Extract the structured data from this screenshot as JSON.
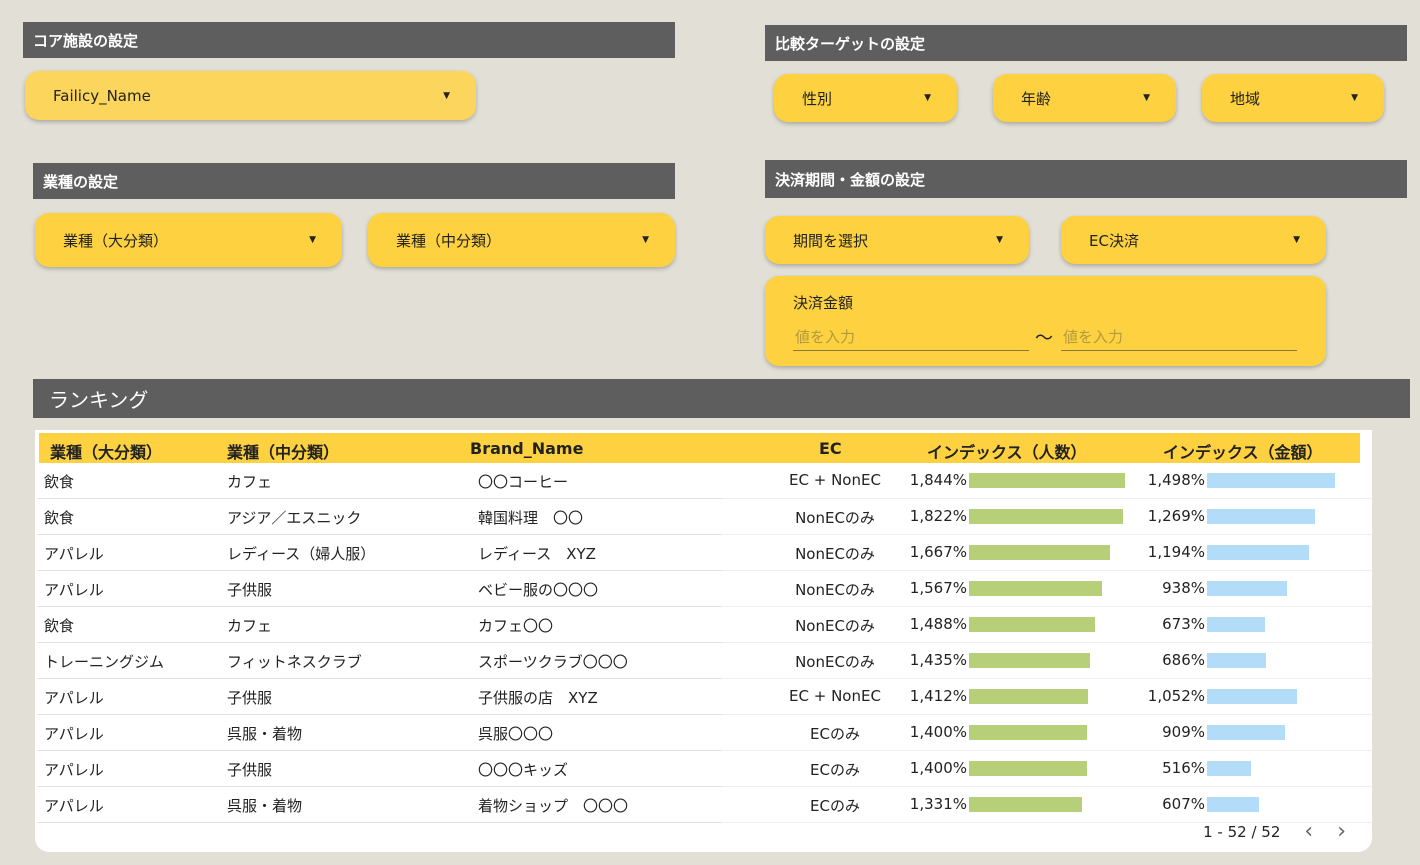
{
  "core": {
    "header": "コア施設の設定",
    "facility": "Failicy_Name"
  },
  "target": {
    "header": "比較ターゲットの設定",
    "gender": "性別",
    "age": "年齢",
    "region": "地域"
  },
  "industry": {
    "header": "業種の設定",
    "major": "業種（大分類）",
    "middle": "業種（中分類）"
  },
  "payment": {
    "header": "決済期間・金額の設定",
    "period": "期間を選択",
    "ec": "EC決済",
    "amount_label": "決済金額",
    "placeholder": "値を入力",
    "tilde": "〜"
  },
  "ranking": {
    "header": "ランキング",
    "columns": [
      "業種（大分類）",
      "業種（中分類）",
      "Brand_Name",
      "EC",
      "インデックス（人数）",
      "インデックス（金額）"
    ],
    "rows": [
      {
        "major": "飲食",
        "middle": "カフェ",
        "brand": "〇〇コーヒー",
        "ec": "EC + NonEC",
        "idx_people": "1,844%",
        "people": 1844,
        "idx_amount": "1,498%",
        "amount": 1498
      },
      {
        "major": "飲食",
        "middle": "アジア／エスニック",
        "brand": "韓国料理　〇〇",
        "ec": "NonECのみ",
        "idx_people": "1,822%",
        "people": 1822,
        "idx_amount": "1,269%",
        "amount": 1269
      },
      {
        "major": "アパレル",
        "middle": "レディース（婦人服）",
        "brand": "レディース　XYZ",
        "ec": "NonECのみ",
        "idx_people": "1,667%",
        "people": 1667,
        "idx_amount": "1,194%",
        "amount": 1194
      },
      {
        "major": "アパレル",
        "middle": "子供服",
        "brand": "ベビー服の〇〇〇",
        "ec": "NonECのみ",
        "idx_people": "1,567%",
        "people": 1567,
        "idx_amount": "938%",
        "amount": 938
      },
      {
        "major": "飲食",
        "middle": "カフェ",
        "brand": "カフェ〇〇",
        "ec": "NonECのみ",
        "idx_people": "1,488%",
        "people": 1488,
        "idx_amount": "673%",
        "amount": 673
      },
      {
        "major": "トレーニングジム",
        "middle": "フィットネスクラブ",
        "brand": "スポーツクラブ〇〇〇",
        "ec": "NonECのみ",
        "idx_people": "1,435%",
        "people": 1435,
        "idx_amount": "686%",
        "amount": 686
      },
      {
        "major": "アパレル",
        "middle": "子供服",
        "brand": "子供服の店　XYZ",
        "ec": "EC + NonEC",
        "idx_people": "1,412%",
        "people": 1412,
        "idx_amount": "1,052%",
        "amount": 1052
      },
      {
        "major": "アパレル",
        "middle": "呉服・着物",
        "brand": "呉服〇〇〇",
        "ec": "ECのみ",
        "idx_people": "1,400%",
        "people": 1400,
        "idx_amount": "909%",
        "amount": 909
      },
      {
        "major": "アパレル",
        "middle": "子供服",
        "brand": "〇〇〇キッズ",
        "ec": "ECのみ",
        "idx_people": "1,400%",
        "people": 1400,
        "idx_amount": "516%",
        "amount": 516
      },
      {
        "major": "アパレル",
        "middle": "呉服・着物",
        "brand": "着物ショップ　〇〇〇",
        "ec": "ECのみ",
        "idx_people": "1,331%",
        "people": 1331,
        "idx_amount": "607%",
        "amount": 607
      }
    ],
    "pagination": "1 - 52 / 52",
    "prev_icon": "‹",
    "next_icon": "›"
  },
  "colors": {
    "accent": "#fdd13f",
    "header_bg": "#5e5e5e",
    "bar_people": "#b6cf78",
    "bar_amount": "#b3dcf9"
  }
}
